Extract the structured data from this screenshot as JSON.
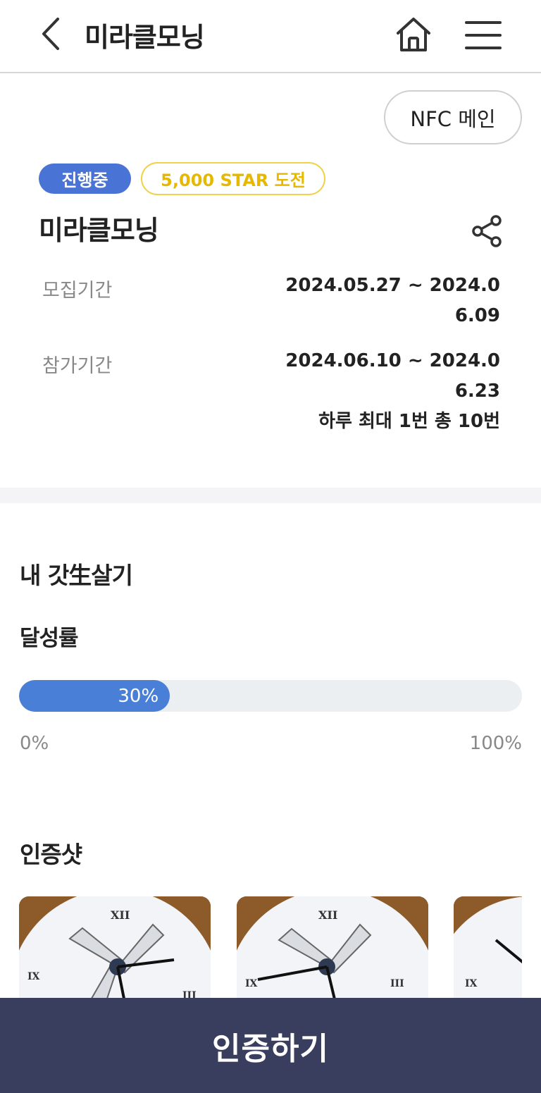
{
  "header": {
    "title": "미라클모닝",
    "back_icon": "chevron-left-icon",
    "home_icon": "home-icon",
    "menu_icon": "hamburger-menu-icon"
  },
  "nfc_button": "NFC 메인",
  "badges": {
    "status": "진행중",
    "reward": "5,000 STAR 도전",
    "status_color": "#4a73d6",
    "reward_color": "#f0d24a"
  },
  "challenge": {
    "title": "미라클모닝",
    "share_icon": "share-icon"
  },
  "info": {
    "recruit_label": "모집기간",
    "recruit_value": "2024.05.27 ~ 2024.06.09",
    "participate_label": "참가기간",
    "participate_value": "2024.06.10 ~ 2024.06.23",
    "frequency": "하루 최대 1번 총 10번"
  },
  "my_section": {
    "title": "내 갓生살기",
    "achievement_label": "달성률",
    "progress_percent": 30,
    "progress_text": "30%",
    "min_label": "0%",
    "max_label": "100%"
  },
  "proof_section": {
    "title": "인증샷",
    "photos": [
      {
        "alt": "windmill clock photo"
      },
      {
        "alt": "windmill clock photo"
      },
      {
        "alt": "windmill clock photo"
      }
    ]
  },
  "cta": {
    "label": "인증하기",
    "color": "#393d5e"
  }
}
